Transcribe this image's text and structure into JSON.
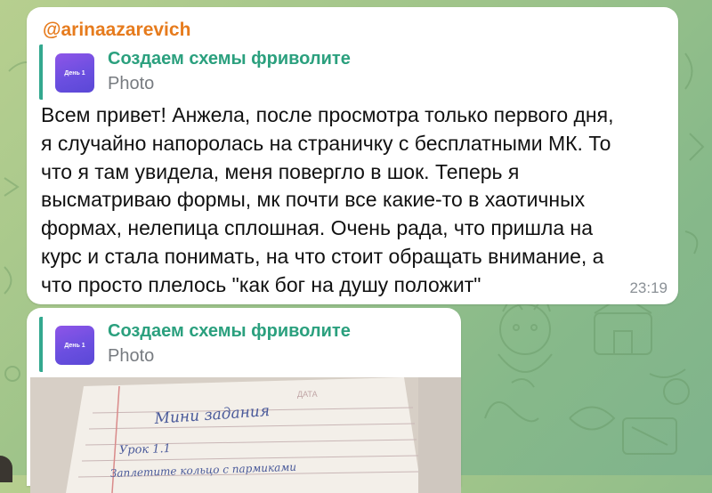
{
  "messages": [
    {
      "author": "@arinaazarevich",
      "reply": {
        "title": "Создаем схемы фриволите",
        "subtitle": "Photo",
        "thumb_text": "День 1"
      },
      "text_lines": [
        "Всем привет! Анжела, после просмотра только первого дня,",
        "я случайно напоролась на страничку с бесплатными МК. То",
        "что я там увидела, меня повергло в шок. Теперь я",
        "высматриваю формы, мк почти все какие-то в хаотичных",
        "формах, нелепица сплошная. Очень рада, что пришла на",
        "курс и стала понимать, на что стоит обращать внимание, а",
        "что просто плелось \"как бог на душу положит\""
      ],
      "time": "23:19"
    },
    {
      "reply": {
        "title": "Создаем схемы фриволите",
        "subtitle": "Photo",
        "thumb_text": "День 1"
      },
      "photo": {
        "header_text": "ДАТА",
        "handwriting": [
          "Мини задания",
          "Урок 1.1",
          "Заплетите кольцо с пармиками"
        ]
      }
    }
  ],
  "colors": {
    "author": "#e67b1d",
    "reply_accent": "#33a88f",
    "reply_title": "#2ba07e",
    "bubble": "#ffffff",
    "background": "#9fc48a"
  }
}
